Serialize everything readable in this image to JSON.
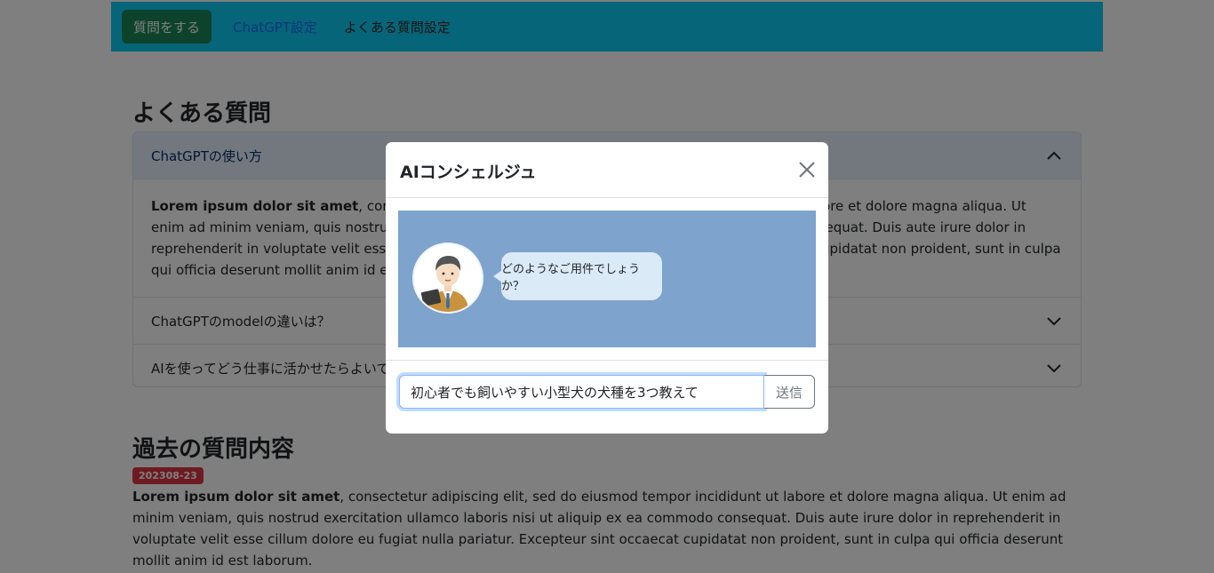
{
  "navbar": {
    "items": [
      {
        "label": "質問をする"
      },
      {
        "label": "ChatGPT設定"
      },
      {
        "label": "よくある質問設定"
      }
    ]
  },
  "faq": {
    "title": "よくある質問",
    "items": [
      {
        "question": "ChatGPTの使い方",
        "answer_bold": "Lorem ipsum dolor sit amet",
        "answer_rest": ", consectetur adipiscing elit, sed do eiusmod tempor incididunt ut labore et dolore magna aliqua. Ut enim ad minim veniam, quis nostrud exercitation ullamco laboris nisi ut aliquip ex ea commodo consequat. Duis aute irure dolor in reprehenderit in voluptate velit esse cillum dolore eu fugiat nulla pariatur. Excepteur sint occaecat cupidatat non proident, sunt in culpa qui officia deserunt mollit anim id est laborum."
      },
      {
        "question": "ChatGPTのmodelの違いは？"
      },
      {
        "question": "AIを使ってどう仕事に活かせたらよいですか"
      }
    ]
  },
  "history": {
    "title": "過去の質問内容",
    "date_badge": "202308-23",
    "text_bold": "Lorem ipsum dolor sit amet",
    "text_rest": ", consectetur adipiscing elit, sed do eiusmod tempor incididunt ut labore et dolore magna aliqua. Ut enim ad minim veniam, quis nostrud exercitation ullamco laboris nisi ut aliquip ex ea commodo consequat. Duis aute irure dolor in reprehenderit in voluptate velit esse cillum dolore eu fugiat nulla pariatur. Excepteur sint occaecat cupidatat non proident, sunt in culpa qui officia deserunt mollit anim id est laborum."
  },
  "modal": {
    "title": "AIコンシェルジュ",
    "assistant_message": "どのようなご用件でしょうか？",
    "input_value": "初心者でも飼いやすい小型犬の犬種を3つ教えて",
    "send_label": "送信"
  },
  "colors": {
    "navbar": "#0dcaf0",
    "primary_button": "#198754",
    "badge": "#dc3545",
    "chat_background": "#7ea3cc",
    "bubble": "#dbeaf7"
  },
  "icons": [
    "close-icon",
    "chevron-up-icon",
    "chevron-down-icon",
    "concierge-avatar"
  ]
}
